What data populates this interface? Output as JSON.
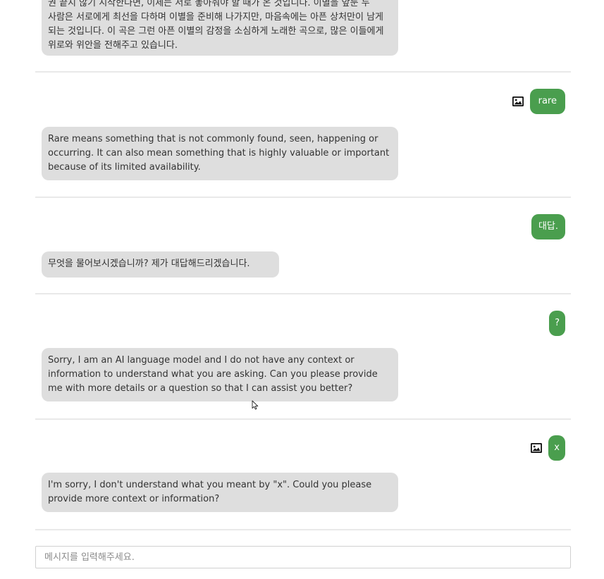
{
  "messages": [
    {
      "bot": "권 끝지 않기 시작한다면, 이제는 서로 놓아줘야 할 때가 온 것입니다. 이별을 앞둔 두 사람은 서로에게 최선을 다하며 이별을 준비해 나가지만, 마음속에는 아픈 상처만이 남게 되는 것입니다. 이 곡은 그런 아픈 이별의 감정을 소심하게 노래한 곡으로, 많은 이들에게 위로와 위안을 전해주고 있습니다."
    },
    {
      "user": "rare",
      "has_image": true,
      "bot": "Rare means something that is not commonly found, seen, happening or occurring. It can also mean something that is highly valuable or important because of its limited availability."
    },
    {
      "user": "대답.",
      "has_image": false,
      "bot": "무엇을 물어보시겠습니까? 제가 대답해드리겠습니다."
    },
    {
      "user": "?",
      "has_image": false,
      "bot": "Sorry, I am an AI language model and I do not have any context or information to understand what you are asking. Can you please provide me with more details or a question so that I can assist you better?"
    },
    {
      "user": "x",
      "has_image": true,
      "bot": "I'm sorry, I don't understand what you meant by \"x\". Could you please provide more context or information?"
    }
  ],
  "input": {
    "placeholder": "메시지를 입력해주세요.",
    "value": ""
  },
  "icons": {
    "attachment": "image-icon",
    "cursor": "mouse-pointer-icon"
  },
  "colors": {
    "user_bubble": "#4a9e4e",
    "bot_bubble": "#dedede",
    "divider": "#e9e9e9"
  }
}
